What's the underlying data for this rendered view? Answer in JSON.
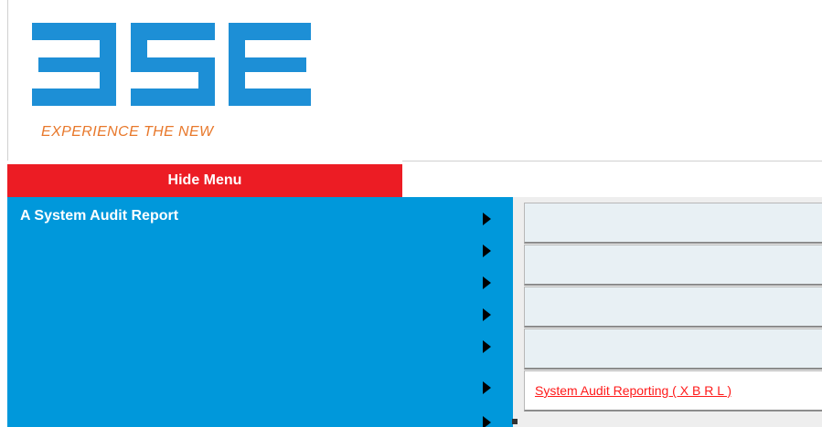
{
  "logo": {
    "wordmark": "BSE",
    "tagline": "EXPERIENCE THE NEW",
    "brand_blue": "#1d8fd6",
    "tagline_color": "#e8782b"
  },
  "menu": {
    "toggle_label": "Hide Menu",
    "toggle_color": "#ec1c24",
    "panel_color": "#0098db",
    "title": "A System Audit Report",
    "arrow_icon": "caret-right-icon"
  },
  "submenu": {
    "items": [
      {
        "label": ""
      },
      {
        "label": ""
      },
      {
        "label": ""
      },
      {
        "label": ""
      },
      {
        "label": "System Audit Reporting ( X B R L )"
      }
    ],
    "link_color": "#ff1a1a"
  }
}
